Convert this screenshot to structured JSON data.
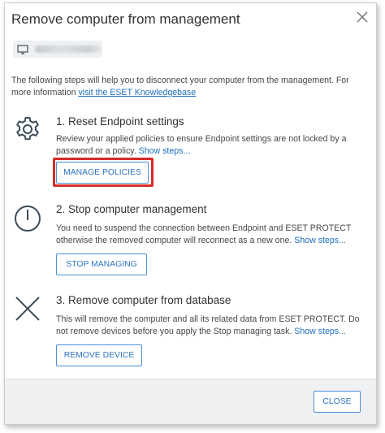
{
  "dialog": {
    "title": "Remove computer from management",
    "close_icon": "close-icon"
  },
  "computer": {
    "icon": "monitor-icon",
    "name_redacted": true
  },
  "intro": {
    "text": "The following steps will help you to disconnect your computer from the management. For more information ",
    "link": "visit the ESET Knowledgebase"
  },
  "steps": [
    {
      "icon": "gear-icon",
      "title": "1. Reset Endpoint settings",
      "desc": "Review your applied policies to ensure Endpoint settings are not locked by a password or a policy. ",
      "link": "Show steps...",
      "button": "MANAGE POLICIES",
      "highlighted": true
    },
    {
      "icon": "power-icon",
      "title": "2. Stop computer management",
      "desc": "You need to suspend the connection between Endpoint and ESET PROTECT otherwise the removed computer will reconnect as a new one. ",
      "link": "Show steps...",
      "button": "STOP MANAGING"
    },
    {
      "icon": "x-icon",
      "title": "3. Remove computer from database",
      "desc": "This will remove the computer and all its related data from ESET PROTECT. Do not remove devices before you apply the Stop managing task. ",
      "link": "Show steps...",
      "button": "REMOVE DEVICE"
    }
  ],
  "footer": {
    "close_label": "CLOSE"
  },
  "colors": {
    "accent": "#2f74c4",
    "link": "#1f6fc0",
    "highlight": "#d52b2b",
    "icon": "#3d4c59",
    "footer_bg": "#eef0f2"
  }
}
